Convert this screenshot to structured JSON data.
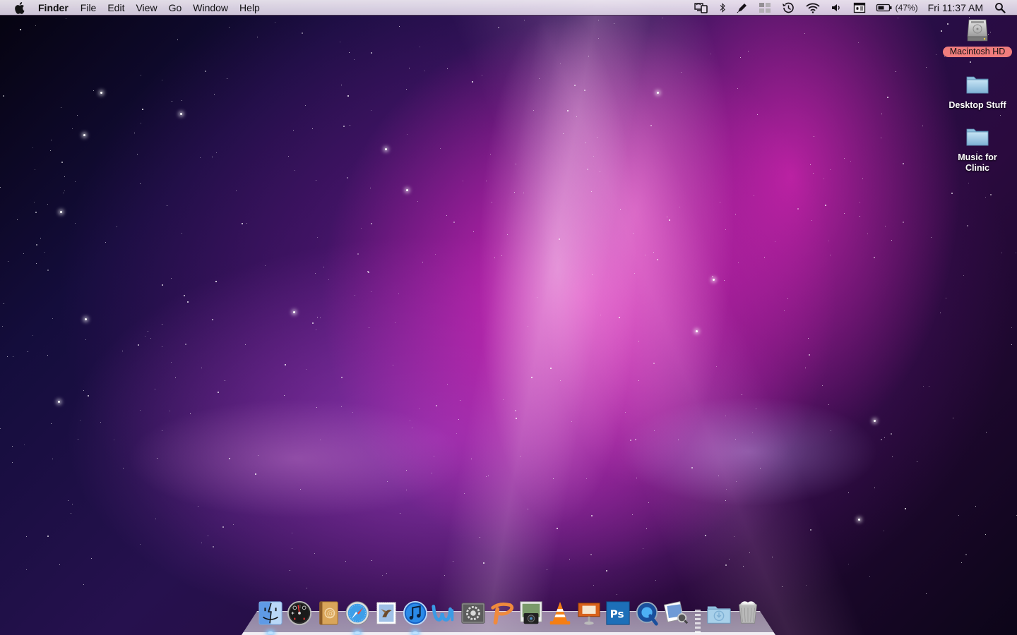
{
  "menubar": {
    "app_name": "Finder",
    "menus": [
      "File",
      "Edit",
      "View",
      "Go",
      "Window",
      "Help"
    ],
    "status_items": [
      {
        "name": "display-mirroring-icon"
      },
      {
        "name": "bluetooth-icon"
      },
      {
        "name": "ink-pen-icon"
      },
      {
        "name": "spaces-icon"
      },
      {
        "name": "time-machine-icon"
      },
      {
        "name": "wifi-icon"
      },
      {
        "name": "volume-icon"
      },
      {
        "name": "input-menu-icon"
      },
      {
        "name": "battery-icon"
      }
    ],
    "battery_percent": "(47%)",
    "clock": "Fri 11:37 AM",
    "spotlight": "spotlight-search-icon"
  },
  "desktop": {
    "icons": [
      {
        "label": "Macintosh HD",
        "type": "hard-drive",
        "selected": true
      },
      {
        "label": "Desktop Stuff",
        "type": "folder",
        "selected": false
      },
      {
        "label": "Music for Clinic",
        "type": "folder",
        "selected": false
      }
    ]
  },
  "dock": {
    "apps": [
      {
        "name": "Finder",
        "running": true
      },
      {
        "name": "Dashboard",
        "running": false
      },
      {
        "name": "Address Book",
        "running": false
      },
      {
        "name": "Safari",
        "running": true
      },
      {
        "name": "Mail",
        "running": false
      },
      {
        "name": "iTunes",
        "running": true
      },
      {
        "name": "Microsoft Word",
        "running": false
      },
      {
        "name": "System Preferences",
        "running": false
      },
      {
        "name": "Microsoft PowerPoint",
        "running": false
      },
      {
        "name": "Image Capture",
        "running": false
      },
      {
        "name": "VLC",
        "running": false
      },
      {
        "name": "Keynote",
        "running": false
      },
      {
        "name": "Adobe Photoshop",
        "running": false
      },
      {
        "name": "QuickTime Player",
        "running": false
      },
      {
        "name": "Preview",
        "running": false
      }
    ],
    "stacks": [
      {
        "name": "Downloads"
      },
      {
        "name": "Trash"
      }
    ],
    "photoshop_label": "Ps"
  }
}
